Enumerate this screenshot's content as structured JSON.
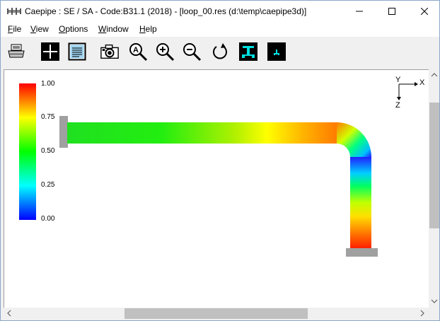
{
  "window": {
    "title": "Caepipe : SE / SA - Code:B31.1 (2018) -  [loop_00.res (d:\\temp\\caepipe3d)]"
  },
  "menu": {
    "items": [
      {
        "label": "File",
        "hotkey": "F",
        "rest": "ile"
      },
      {
        "label": "View",
        "hotkey": "V",
        "rest": "iew"
      },
      {
        "label": "Options",
        "hotkey": "O",
        "rest": "ptions"
      },
      {
        "label": "Window",
        "hotkey": "W",
        "rest": "indow"
      },
      {
        "label": "Help",
        "hotkey": "H",
        "rest": "elp"
      }
    ]
  },
  "toolbar": {
    "buttons": [
      {
        "name": "print-icon"
      },
      {
        "name": "crosshair-icon"
      },
      {
        "name": "text-list-icon"
      },
      {
        "name": "camera-icon"
      },
      {
        "name": "zoom-all-icon"
      },
      {
        "name": "zoom-in-icon"
      },
      {
        "name": "zoom-out-icon"
      },
      {
        "name": "rotate-icon"
      },
      {
        "name": "show-supports-icon"
      },
      {
        "name": "show-supports-small-icon"
      }
    ]
  },
  "legend": {
    "values": [
      "1.00",
      "0.75",
      "0.50",
      "0.25",
      "0.00"
    ]
  },
  "axes": {
    "y": "Y",
    "x": "X",
    "z": "Z"
  },
  "colors": {
    "scale_high": "#ff0000",
    "scale_mid": "#00ff00",
    "scale_low": "#0000ff",
    "support": "#a0a0a0"
  },
  "scrollbars": {
    "vertical_position": 0.24,
    "horizontal_position": 0.33
  }
}
